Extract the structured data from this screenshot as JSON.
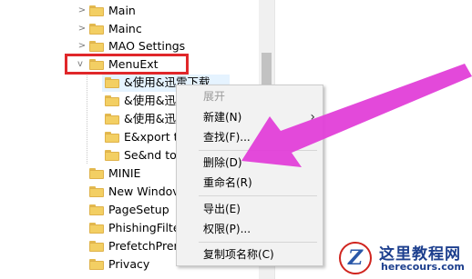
{
  "tree": {
    "items": [
      {
        "label": "Main",
        "chevron": ">",
        "level": "child"
      },
      {
        "label": "Mainc",
        "chevron": ">",
        "level": "child"
      },
      {
        "label": "MAO Settings",
        "chevron": ">",
        "level": "child"
      },
      {
        "label": "MenuExt",
        "chevron": "v",
        "level": "child",
        "highlighted": true
      },
      {
        "label": "&使用&迅雷下载",
        "chevron": "",
        "level": "grandchild",
        "selected": true
      },
      {
        "label": "&使用&迅",
        "chevron": "",
        "level": "grandchild"
      },
      {
        "label": "&使用&迅",
        "chevron": "",
        "level": "grandchild"
      },
      {
        "label": "E&xport t",
        "chevron": "",
        "level": "grandchild"
      },
      {
        "label": "Se&nd to",
        "chevron": "",
        "level": "grandchild"
      },
      {
        "label": "MINIE",
        "chevron": "",
        "level": "child"
      },
      {
        "label": "New Windov",
        "chevron": "",
        "level": "child"
      },
      {
        "label": "PageSetup",
        "chevron": "",
        "level": "child"
      },
      {
        "label": "PhishingFilte",
        "chevron": "",
        "level": "child"
      },
      {
        "label": "PrefetchPrer",
        "chevron": "",
        "level": "child"
      },
      {
        "label": "Privacy",
        "chevron": "",
        "level": "child"
      }
    ]
  },
  "context_menu": {
    "items": [
      {
        "label": "展开",
        "disabled": true
      },
      {
        "label": "新建(N)",
        "disabled": false,
        "has_submenu": true
      },
      {
        "label": "查找(F)...",
        "disabled": false
      },
      {
        "label": "删除(D)",
        "disabled": false
      },
      {
        "label": "重命名(R)",
        "disabled": false
      },
      {
        "label": "导出(E)",
        "disabled": false
      },
      {
        "label": "权限(P)...",
        "disabled": false
      },
      {
        "label": "复制项名称(C)",
        "disabled": false
      }
    ],
    "submenu_glyph": "›"
  },
  "watermark": {
    "badge_letter": "Z",
    "title": "这里教程网",
    "url": "herecours.com"
  },
  "colors": {
    "highlight_box": "#e0272a",
    "arrow": "#e23fd8",
    "selection": "#e5f3ff",
    "folder": "#f3cf63"
  },
  "icons": [
    "folder-icon",
    "chevron-right-icon",
    "chevron-down-icon",
    "submenu-arrow-icon"
  ]
}
